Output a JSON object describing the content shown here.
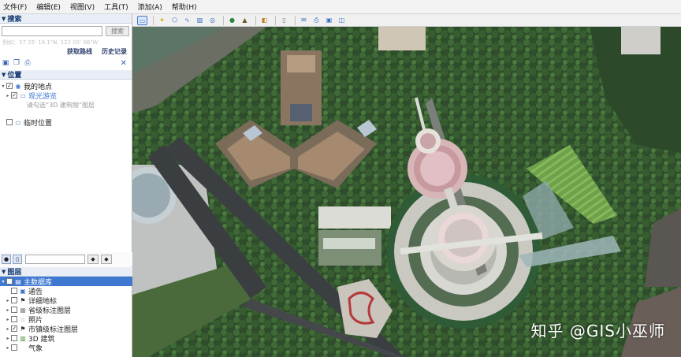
{
  "menu": [
    "文件(F)",
    "编辑(E)",
    "视图(V)",
    "工具(T)",
    "添加(A)",
    "帮助(H)"
  ],
  "search": {
    "title": "搜索",
    "button": "搜索",
    "coord_hint": "例如：37 25' 19.1\"N, 122 05' 06\"W",
    "get_route": "获取路线",
    "history": "历史记录"
  },
  "places": {
    "title": "位置",
    "my_places": "我的地点",
    "sightseeing": "观光游览",
    "hint": "请勾选“3D 建筑物”图层",
    "temp": "临时位置"
  },
  "layers": {
    "title": "图层",
    "items": [
      "主数据库",
      "通告",
      "详细地标",
      "省级标注图层",
      "照片",
      "市镇级标注图层",
      "3D 建筑",
      "气象"
    ]
  },
  "watermark": "知乎 @GIS小巫师",
  "colors": {
    "accent": "#3f78d1",
    "header": "#12356e"
  }
}
